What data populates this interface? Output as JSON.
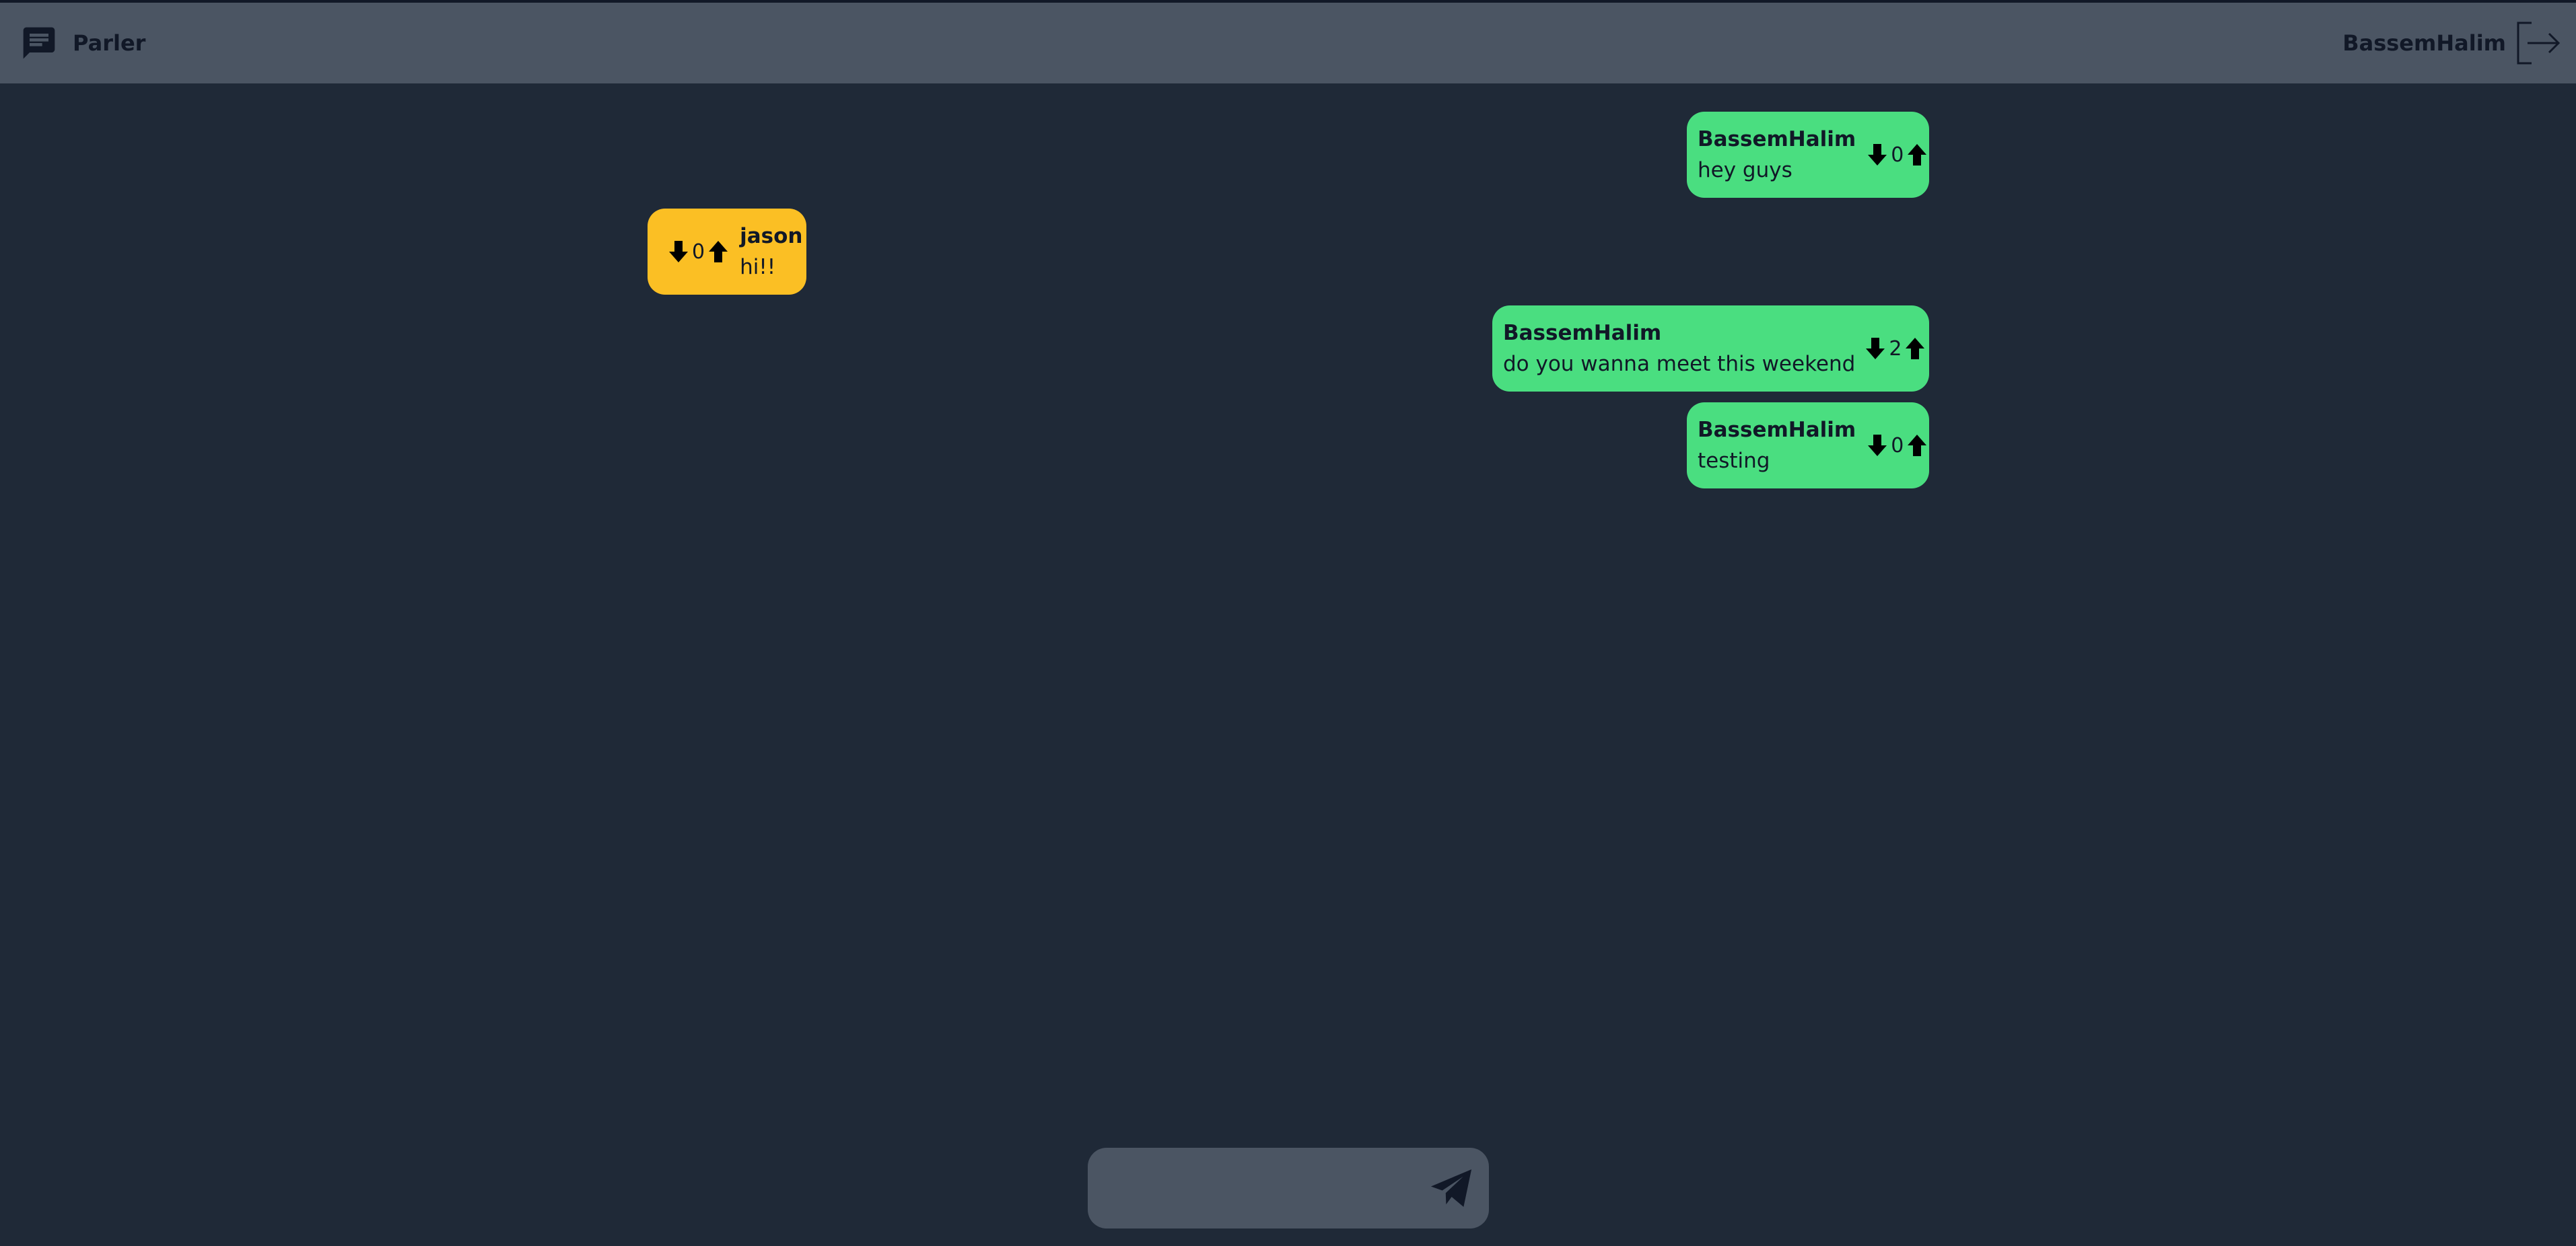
{
  "app": {
    "title": "Parler",
    "current_user": "BassemHalim"
  },
  "icons": {
    "brand": "chat-bubble-icon",
    "logout": "logout-icon",
    "downvote": "arrow-down-icon",
    "upvote": "arrow-up-icon",
    "send": "paper-plane-icon"
  },
  "colors": {
    "background": "#1f2937",
    "navbar": "#4b5563",
    "own_message": "#4ade80",
    "other_message": "#fbbf24",
    "composer": "#4b5563"
  },
  "messages": [
    {
      "user": "BassemHalim",
      "text": "hey guys",
      "votes": "0",
      "own": true
    },
    {
      "user": "jason",
      "text": "hi!!",
      "votes": "0",
      "own": false
    },
    {
      "user": "BassemHalim",
      "text": "do you wanna meet this weekend",
      "votes": "2",
      "own": true
    },
    {
      "user": "BassemHalim",
      "text": "testing",
      "votes": "0",
      "own": true
    }
  ],
  "composer": {
    "value": "",
    "placeholder": ""
  }
}
